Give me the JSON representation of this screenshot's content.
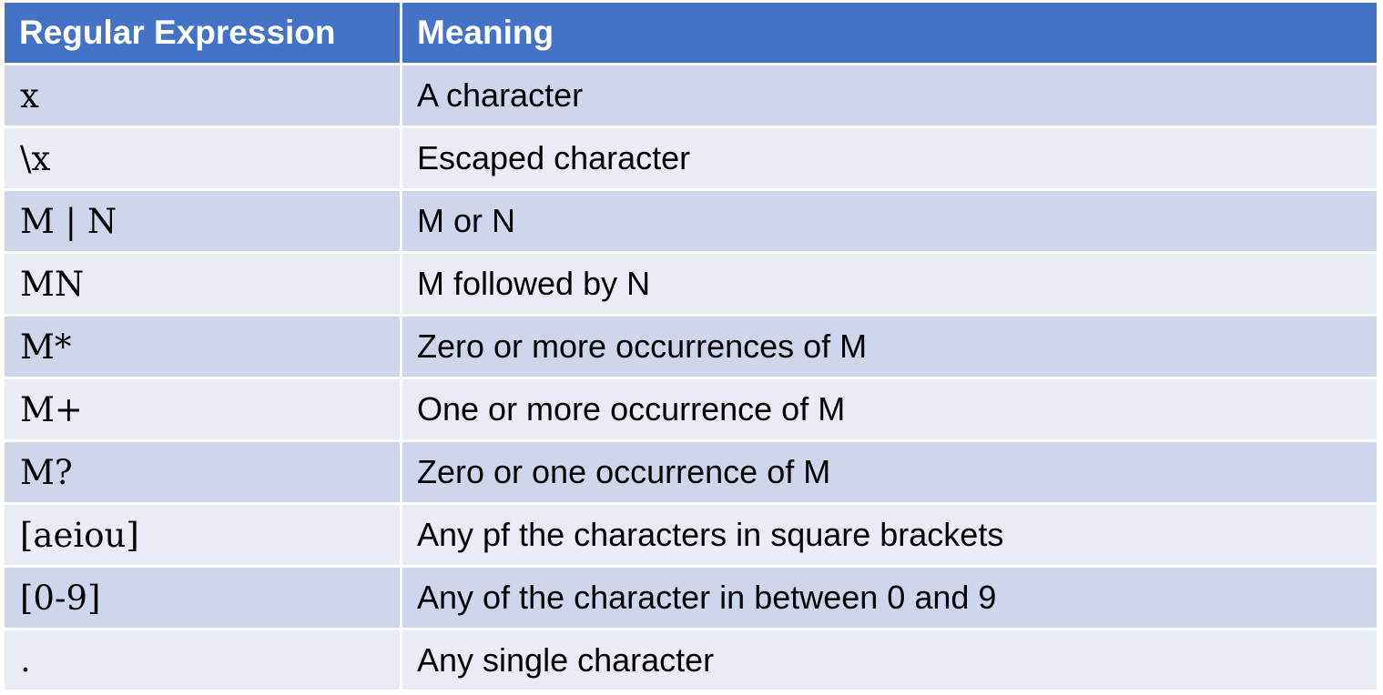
{
  "header": {
    "col1": "Regular Expression",
    "col2": "Meaning"
  },
  "rows": [
    {
      "expr": "x",
      "meaning": "A character"
    },
    {
      "expr": "\\x",
      "meaning": "Escaped character"
    },
    {
      "expr": "M | N",
      "meaning": "M or N"
    },
    {
      "expr": "MN",
      "meaning": "M followed by N"
    },
    {
      "expr": "M*",
      "meaning": "Zero or more occurrences of M"
    },
    {
      "expr": "M+",
      "meaning": "One or more occurrence of M"
    },
    {
      "expr": "M?",
      "meaning": "Zero or one occurrence of M"
    },
    {
      "expr": "[aeiou]",
      "meaning": "Any pf the characters in square brackets"
    },
    {
      "expr": "[0-9]",
      "meaning": "Any of the character in between 0 and 9"
    },
    {
      "expr": ".",
      "meaning": "Any single character"
    }
  ],
  "colors": {
    "header_bg": "#4472c4",
    "row_odd_bg": "#cfd5ea",
    "row_even_bg": "#e9ebf5"
  }
}
